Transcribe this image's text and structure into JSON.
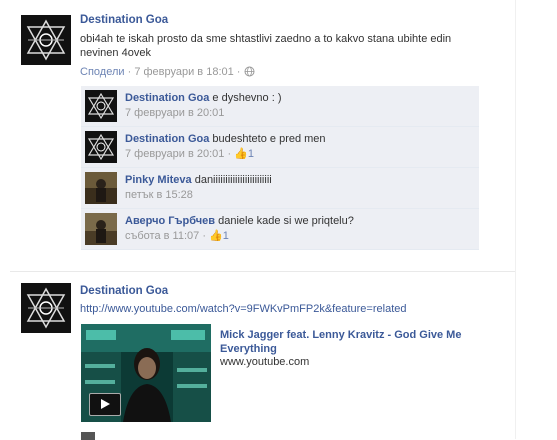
{
  "colors": {
    "link": "#3b5998",
    "meta": "#999999",
    "comment_bg": "#edeff4",
    "like_blue": "#6d84b4"
  },
  "posts": [
    {
      "author": "Destination Goa",
      "text": "obi4ah te iskah prosto da sme shtastlivi zaedno a to kakvo stana ubihte edin nevinen 4ovek",
      "share_label": "Сподели",
      "timestamp": "7 февруари в 18:01",
      "privacy_icon": "globe-icon",
      "comments": [
        {
          "author": "Destination Goa",
          "text": "e dyshevno : )",
          "time": "7 февруари в 20:01",
          "likes": "",
          "avatar": "goa-avatar"
        },
        {
          "author": "Destination Goa",
          "text": "budeshteto e pred men",
          "time": "7 февруари в 20:01",
          "likes": "1",
          "avatar": "goa-avatar"
        },
        {
          "author": "Pinky Miteva",
          "text": "daniiiiiiiiiiiiiiiiiiiiiiii",
          "time": "петък в 15:28",
          "likes": "",
          "avatar": "pinky-avatar"
        },
        {
          "author": "Аверчо Гърбчев",
          "text": "daniele kade si we priqtelu?",
          "time": "събота в 11:07",
          "likes": "1",
          "avatar": "avercho-avatar"
        }
      ]
    },
    {
      "author": "Destination Goa",
      "url": "http://www.youtube.com/watch?v=9FWKvPmFP2k&feature=related",
      "video": {
        "title": "Mick Jagger feat. Lenny Kravitz - God Give Me Everything",
        "domain": "www.youtube.com",
        "play_icon": "play-icon"
      }
    }
  ],
  "separators": {
    "dot": "·"
  }
}
